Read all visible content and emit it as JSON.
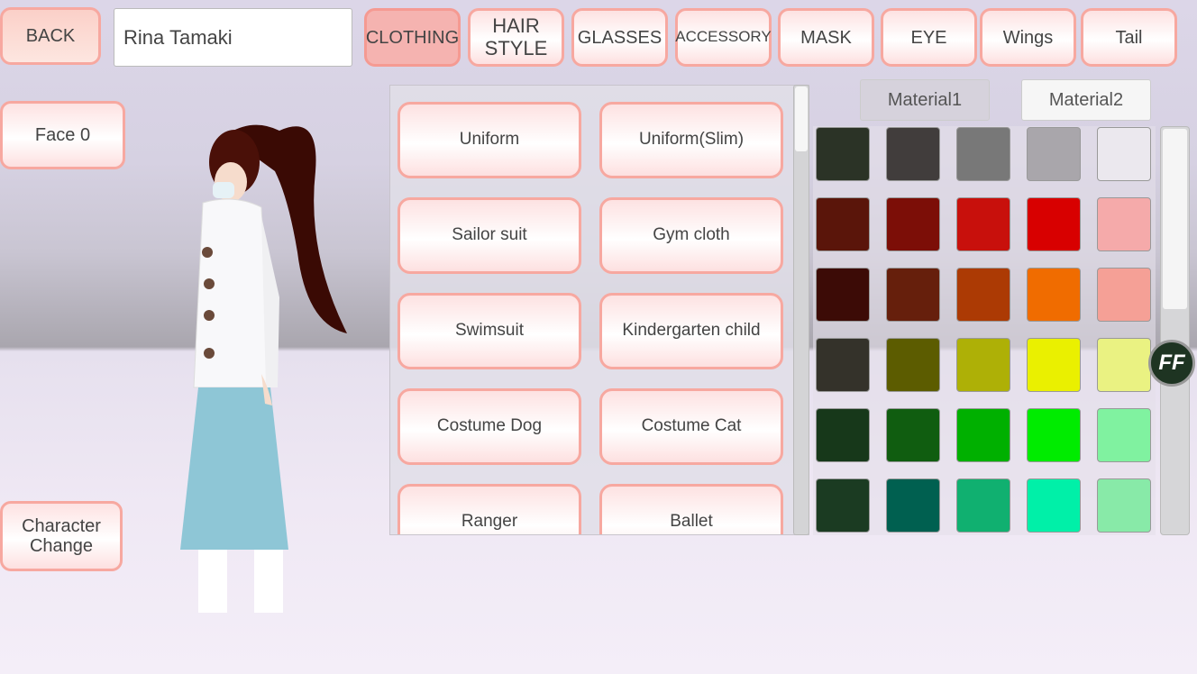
{
  "top_bar": {
    "back_label": "BACK",
    "name_value": "Rina Tamaki",
    "tabs": [
      {
        "label": "CLOTHING",
        "selected": true
      },
      {
        "label": "HAIR STYLE"
      },
      {
        "label": "GLASSES"
      },
      {
        "label": "ACCESSORY"
      },
      {
        "label": "MASK"
      },
      {
        "label": "EYE"
      },
      {
        "label": "Wings"
      },
      {
        "label": "Tail"
      }
    ]
  },
  "left": {
    "face_label": "Face 0",
    "character_change_label": "Character Change"
  },
  "clothing_items": [
    "Uniform",
    "Uniform(Slim)",
    "Sailor suit",
    "Gym cloth",
    "Swimsuit",
    "Kindergarten child",
    "Costume Dog",
    "Costume Cat",
    "Ranger",
    "Ballet"
  ],
  "materials": {
    "tabs": [
      "Material1",
      "Material2"
    ],
    "selected": "Material1"
  },
  "colors": [
    [
      "#2b3326",
      "#413d3c",
      "#787878",
      "#a9a6ab",
      "#ebe8ee"
    ],
    [
      "#5a150a",
      "#7c0e07",
      "#c8100c",
      "#d80000",
      "#f5aaaa"
    ],
    [
      "#3c0b06",
      "#661f0c",
      "#ac3a04",
      "#f06c00",
      "#f5a096"
    ],
    [
      "#34322a",
      "#5c5c00",
      "#aeb006",
      "#eaf000",
      "#eaf282"
    ],
    [
      "#17381a",
      "#105d10",
      "#00b000",
      "#00ec00",
      "#80f2a0"
    ],
    [
      "#1b3b22",
      "#006050",
      "#10b070",
      "#00f0a8",
      "#88eaa8"
    ]
  ],
  "ff_button_label": "FF"
}
